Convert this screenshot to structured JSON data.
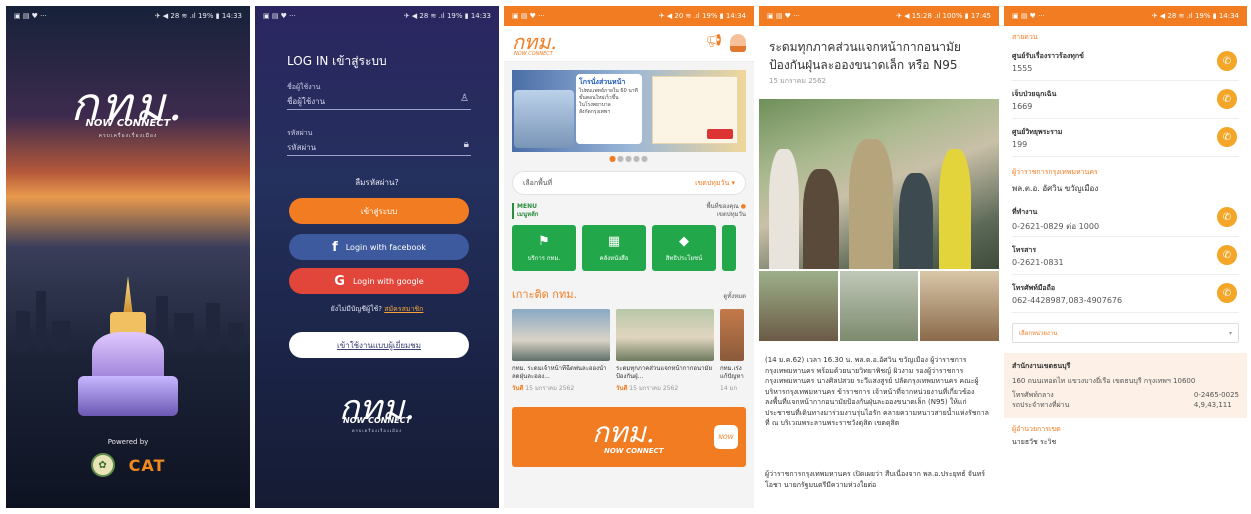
{
  "status": {
    "left_icons": "▣ ▤ ♥ ···",
    "p1_right": "✈ ◀ 28 ≋ .ıl 19% ▮ 14:33",
    "p2_right": "✈ ◀ 28 ≋ .ıl 19% ▮ 14:33",
    "p3_right": "✈ ◀ 20 ≋ .ıl 19% ▮ 14:34",
    "p4_right": "✈ ◀ 15:28 .ıl 100% ▮ 17:45",
    "p5_right": "✈ ◀ 28 ≋ .ıl 19% ▮ 14:34"
  },
  "splash": {
    "logo": "กทม.",
    "now_connect": "NOW CONNECT",
    "tagline": "ครบเครื่องเรื่องเมือง",
    "powered_by": "Powered by",
    "partner": "CAT"
  },
  "login": {
    "title": "LOG IN เข้าสู่ระบบ",
    "username_label": "ชื่อผู้ใช้งาน",
    "username_placeholder": "ชื่อผู้ใช้งาน",
    "password_label": "รหัสผ่าน",
    "password_placeholder": "รหัสผ่าน",
    "forgot": "ลืมรหัสผ่าน?",
    "login_button": "เข้าสู่ระบบ",
    "facebook_button": "Login with facebook",
    "google_button": "Login with google",
    "no_account": "ยังไม่มีบัญชีผู้ใช้?",
    "register": "สมัครสมาชิก",
    "guest_button": "เข้าใช้งานแบบผู้เยี่ยมชม",
    "logo": "กทม.",
    "now_connect": "NOW CONNECT",
    "tagline": "ครบเครื่องเรื่องเมือง"
  },
  "home": {
    "logo": "กทม.",
    "logo_sub": "NOW CONNECT",
    "banner_title": "โกรนั่งส่วนหน้า",
    "banner_lines": [
      "ไปพบแพทย์ภายใน 60 นาที",
      "ขั้นตอนใหม่เร็วขึ้น",
      "ในโรงพยาบาล",
      "สังกัดกรุงเทพฯ"
    ],
    "district_label": "เลือกพื้นที่",
    "district_value": "เขตปทุมวัน",
    "menu_label": "MENU",
    "menu_sub": "เมนูหลัก",
    "location_label": "พื้นที่ของคุณ",
    "location_value": "เขตปทุมวัน",
    "tiles": [
      "บริการ กทม.",
      "คลังหนังสือ",
      "สิทธิประโยชน์"
    ],
    "news_title": "เกาะติด กทม.",
    "news_all": "ดูทั้งหมด",
    "cards": [
      {
        "title": "กทม. ระดมเจ้าหน้าที่ฉีดพ่นละอองน้ำลดฝุ่นละออง...",
        "day": "วันดี",
        "date": "15 มกราคม 2562"
      },
      {
        "title": "ระดมทุกภาคส่วนแจกหน้ากากอนามัยป้องกันฝุ่...",
        "day": "วันดี",
        "date": "15 มกราคม 2562"
      },
      {
        "title": "กทม.เร่ง แก้ปัญหา",
        "day": "",
        "date": "14 มก"
      }
    ],
    "promo_logo": "กทม.",
    "promo_now": "NOW CONNECT",
    "promo_badge": "NOW"
  },
  "article": {
    "title": "ระดมทุกภาคส่วนแจกหน้ากากอนามัยป้องกันฝุ่นละอองขนาดเล็ก หรือ N95",
    "date": "15 มกราคม 2562",
    "body": "(14 ม.ค.62) เวลา 16.30 น. พล.ต.อ.อัศวิน ขวัญเมือง ผู้ว่าราชการกรุงเทพมหานคร พร้อมด้วยนายวิทยาพิชญ์ ผิวงาม รองผู้ว่าราชการกรุงเทพมหานคร นางศิลปสวย ระวีแสงสูรย์ ปลัดกรุงเทพมหานคร คณะผู้บริหารกรุงเทพมหานคร ข้าราชการ เจ้าหน้าที่จากหน่วยงานที่เกี่ยวข้อง ลงพื้นที่แจกหน้ากากอนามัยป้องกันฝุ่นละอองขนาดเล็ก (N95) ให้แก่ประชาชนที่เดินทางมาร่วมงานรุ่นไอรัก คลายความหนาวสายน้ำแห่งรัชกาลที่ ณ บริเวณพระลานพระราชวังดุสิต เขตดุสิต",
    "body2": "ผู้ว่าราชการกรุงเทพมหานคร เปิดเผยว่า สืบเนื่องจาก พล.อ.ประยุทธ์ จันทร์โอชา นายกรัฐมนตรีมีความห่วงใยต่อ"
  },
  "contacts": {
    "hotline_label": "สายด่วน",
    "hotlines": [
      {
        "name": "ศูนย์รับเรื่องราวร้องทุกข์",
        "phone": "1555"
      },
      {
        "name": "เจ็บป่วยฉุกเฉิน",
        "phone": "1669"
      },
      {
        "name": "ศูนย์วิทยุพระราม",
        "phone": "199"
      }
    ],
    "governor_label": "ผู้ว่าราชการกรุงเทพมหานคร",
    "governor_name": "พล.ต.อ. อัศวิน ขวัญเมือง",
    "gov_contacts": [
      {
        "name": "ที่ทำงาน",
        "phone": "0-2621-0829 ต่อ 1000"
      },
      {
        "name": "โทรสาร",
        "phone": "0-2621-0831"
      },
      {
        "name": "โทรศัพท์มือถือ",
        "phone": "062-4428987,083-4907676"
      }
    ],
    "dropdown_placeholder": "เลือกหน่วยงาน",
    "office_name": "สำนักงานเขตธนบุรี",
    "office_address": "160 ถนนเทอดไท แขวงบางยี่เรือ เขตธนบุรี กรุงเทพฯ 10600",
    "central_phone_label": "โทรศัพท์กลาง",
    "central_phone": "0-2465-0025",
    "central_phone_sub": "รถประจำทางที่ผ่าน",
    "bus_lines": "4,9,43,111",
    "next_section": "ผู้อำนวยการเขต",
    "next_value": "นายธวัช ระวิช"
  },
  "colors": {
    "accent": "#f27c22",
    "green": "#22a84b",
    "facebook": "#3d5a9e",
    "google": "#e2453a"
  }
}
